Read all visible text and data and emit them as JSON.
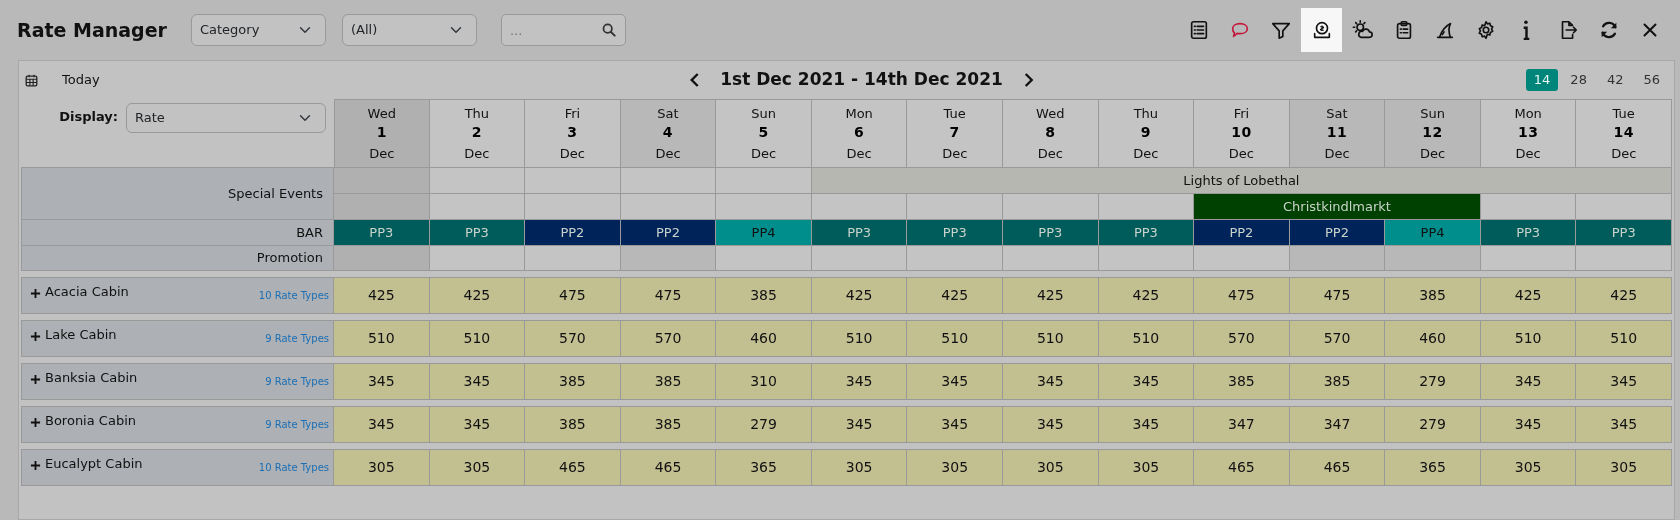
{
  "title": "Rate Manager",
  "filters": {
    "category": "Category",
    "scope": "(All)",
    "search_placeholder": "..."
  },
  "toolbar": [
    {
      "kind": "list",
      "selected": false
    },
    {
      "kind": "comment",
      "selected": false
    },
    {
      "kind": "filter",
      "selected": false
    },
    {
      "kind": "rates",
      "selected": true
    },
    {
      "kind": "weather",
      "selected": false
    },
    {
      "kind": "clipboard",
      "selected": false
    },
    {
      "kind": "fin",
      "selected": false
    },
    {
      "kind": "settings",
      "selected": false
    },
    {
      "kind": "info",
      "selected": false
    },
    {
      "kind": "exit",
      "selected": false
    },
    {
      "kind": "refresh",
      "selected": false
    },
    {
      "kind": "close",
      "selected": false
    }
  ],
  "today": "Today",
  "range": "1st Dec 2021 - 14th Dec 2021",
  "periods": [
    {
      "label": "14",
      "selected": true
    },
    {
      "label": "28",
      "selected": false
    },
    {
      "label": "42",
      "selected": false
    },
    {
      "label": "56",
      "selected": false
    }
  ],
  "display": {
    "label": "Display:",
    "value": "Rate"
  },
  "days": [
    {
      "dow": "Wed",
      "day": "1",
      "month": "Dec",
      "today": true,
      "shaded": false
    },
    {
      "dow": "Thu",
      "day": "2",
      "month": "Dec",
      "today": false,
      "shaded": false
    },
    {
      "dow": "Fri",
      "day": "3",
      "month": "Dec",
      "today": false,
      "shaded": false
    },
    {
      "dow": "Sat",
      "day": "4",
      "month": "Dec",
      "today": false,
      "shaded": true
    },
    {
      "dow": "Sun",
      "day": "5",
      "month": "Dec",
      "today": false,
      "shaded": false
    },
    {
      "dow": "Mon",
      "day": "6",
      "month": "Dec",
      "today": false,
      "shaded": false
    },
    {
      "dow": "Tue",
      "day": "7",
      "month": "Dec",
      "today": false,
      "shaded": false
    },
    {
      "dow": "Wed",
      "day": "8",
      "month": "Dec",
      "today": false,
      "shaded": false
    },
    {
      "dow": "Thu",
      "day": "9",
      "month": "Dec",
      "today": false,
      "shaded": false
    },
    {
      "dow": "Fri",
      "day": "10",
      "month": "Dec",
      "today": false,
      "shaded": false
    },
    {
      "dow": "Sat",
      "day": "11",
      "month": "Dec",
      "today": false,
      "shaded": true
    },
    {
      "dow": "Sun",
      "day": "12",
      "month": "Dec",
      "today": false,
      "shaded": true
    },
    {
      "dow": "Mon",
      "day": "13",
      "month": "Dec",
      "today": false,
      "shaded": false
    },
    {
      "dow": "Tue",
      "day": "14",
      "month": "Dec",
      "today": false,
      "shaded": false
    }
  ],
  "special_events": {
    "label": "Special Events",
    "rows": [
      [
        {
          "kind": "empty"
        },
        {
          "kind": "empty"
        },
        {
          "kind": "empty"
        },
        {
          "kind": "empty"
        },
        {
          "kind": "empty"
        },
        {
          "kind": "event",
          "name": "Lights of Lobethal",
          "color": "#b6b7b0"
        },
        {
          "kind": "continued"
        },
        {
          "kind": "continued"
        },
        {
          "kind": "continued"
        },
        {
          "kind": "continued"
        },
        {
          "kind": "continued"
        },
        {
          "kind": "continued"
        },
        {
          "kind": "continued"
        },
        {
          "kind": "continued"
        }
      ],
      [
        {
          "kind": "empty"
        },
        {
          "kind": "empty"
        },
        {
          "kind": "empty"
        },
        {
          "kind": "empty"
        },
        {
          "kind": "empty"
        },
        {
          "kind": "empty"
        },
        {
          "kind": "empty"
        },
        {
          "kind": "empty"
        },
        {
          "kind": "empty"
        },
        {
          "kind": "event",
          "name": "Christkindlmarkt",
          "color": "#004000"
        },
        {
          "kind": "continued"
        },
        {
          "kind": "continued"
        },
        {
          "kind": "empty"
        },
        {
          "kind": "empty"
        }
      ]
    ]
  },
  "bar": {
    "label": "BAR",
    "cells": [
      {
        "code": "PP3",
        "color": "#005c5a"
      },
      {
        "code": "PP3",
        "color": "#005c5a"
      },
      {
        "code": "PP2",
        "color": "#00245a"
      },
      {
        "code": "PP2",
        "color": "#00245a"
      },
      {
        "code": "PP4",
        "color": "#008e8c"
      },
      {
        "code": "PP3",
        "color": "#005c5a"
      },
      {
        "code": "PP3",
        "color": "#005c5a"
      },
      {
        "code": "PP3",
        "color": "#005c5a"
      },
      {
        "code": "PP3",
        "color": "#005c5a"
      },
      {
        "code": "PP2",
        "color": "#00245a"
      },
      {
        "code": "PP2",
        "color": "#00245a"
      },
      {
        "code": "PP4",
        "color": "#008e8c"
      },
      {
        "code": "PP3",
        "color": "#005c5a"
      },
      {
        "code": "PP3",
        "color": "#005c5a"
      }
    ]
  },
  "promotion": {
    "label": "Promotion"
  },
  "rooms": [
    {
      "name": "Acacia Cabin",
      "rate_types": "10 Rate Types",
      "expanded": false,
      "rates": [
        "425",
        "425",
        "475",
        "475",
        "385",
        "425",
        "425",
        "425",
        "425",
        "475",
        "475",
        "385",
        "425",
        "425"
      ]
    },
    {
      "name": "Lake Cabin",
      "rate_types": "9 Rate Types",
      "expanded": false,
      "rates": [
        "510",
        "510",
        "570",
        "570",
        "460",
        "510",
        "510",
        "510",
        "510",
        "570",
        "570",
        "460",
        "510",
        "510"
      ]
    },
    {
      "name": "Banksia Cabin",
      "rate_types": "9 Rate Types",
      "expanded": false,
      "rates": [
        "345",
        "345",
        "385",
        "385",
        "310",
        "345",
        "345",
        "345",
        "345",
        "385",
        "385",
        "279",
        "345",
        "345"
      ]
    },
    {
      "name": "Boronia Cabin",
      "rate_types": "9 Rate Types",
      "expanded": false,
      "rates": [
        "345",
        "345",
        "385",
        "385",
        "279",
        "345",
        "345",
        "345",
        "345",
        "347",
        "347",
        "279",
        "345",
        "345"
      ]
    },
    {
      "name": "Eucalypt Cabin",
      "rate_types": "10 Rate Types",
      "expanded": false,
      "rates": [
        "305",
        "305",
        "465",
        "465",
        "365",
        "305",
        "305",
        "305",
        "305",
        "465",
        "465",
        "365",
        "305",
        "305"
      ]
    }
  ]
}
